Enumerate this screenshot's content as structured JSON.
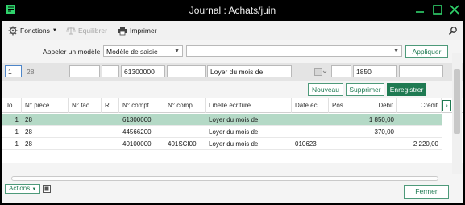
{
  "window": {
    "title": "Journal : Achats/juin"
  },
  "toolbar": {
    "fonctions": "Fonctions",
    "equilibrer": "Equilibrer",
    "imprimer": "Imprimer"
  },
  "model": {
    "label": "Appeler un modèle",
    "select_value": "Modèle de saisie",
    "second_select_value": "",
    "apply_label": "Appliquer"
  },
  "entry": {
    "jour": "1",
    "piece": "28",
    "compte": "61300000",
    "libelle": "Loyer du mois de",
    "montant": "1850"
  },
  "buttons": {
    "nouveau": "Nouveau",
    "supprimer": "Supprimer",
    "enregistrer": "Enregistrer",
    "fermer": "Fermer",
    "actions": "Actions"
  },
  "table": {
    "headers": [
      "Jo...",
      "N° pièce",
      "N° fac...",
      "R...",
      "N° compt...",
      "N° comp...",
      "Libellé écriture",
      "Date éc...",
      "Pos...",
      "Débit",
      "Crédit"
    ],
    "rows": [
      {
        "jour": "1",
        "piece": "28",
        "fac": "",
        "r": "",
        "compte": "61300000",
        "compte2": "",
        "libelle": "Loyer du mois de",
        "date": "",
        "pos": "",
        "debit": "1 850,00",
        "credit": ""
      },
      {
        "jour": "1",
        "piece": "28",
        "fac": "",
        "r": "",
        "compte": "44566200",
        "compte2": "",
        "libelle": "Loyer du mois de",
        "date": "",
        "pos": "",
        "debit": "370,00",
        "credit": ""
      },
      {
        "jour": "1",
        "piece": "28",
        "fac": "",
        "r": "",
        "compte": "40100000",
        "compte2": "401SCI00",
        "libelle": "Loyer du mois de",
        "date": "010623",
        "pos": "",
        "debit": "",
        "credit": "2 220,00"
      }
    ]
  },
  "colors": {
    "accent": "#1f7a52",
    "selected_row": "#b4d9c6",
    "titlebar": "#000000",
    "window_controls": "#2fd36b"
  }
}
